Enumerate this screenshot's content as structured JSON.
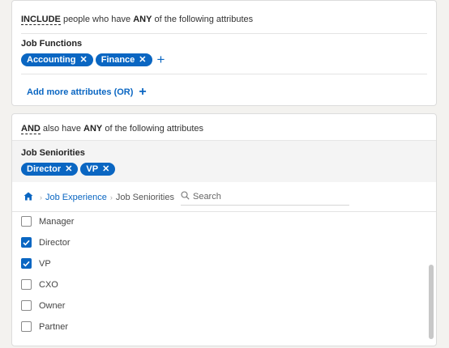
{
  "include_card": {
    "header_keyword": "INCLUDE",
    "header_mid": " people who have ",
    "header_any": "ANY",
    "header_tail": " of the following attributes",
    "section_title": "Job Functions",
    "pills": [
      "Accounting",
      "Finance"
    ],
    "add_more_label": "Add more attributes (OR)"
  },
  "and_card": {
    "header_keyword": "AND",
    "header_mid": " also have ",
    "header_any": "ANY",
    "header_tail": " of the following attributes",
    "section_title": "Job Seniorities",
    "pills": [
      "Director",
      "VP"
    ],
    "breadcrumb": {
      "link": "Job Experience",
      "current": "Job Seniorities"
    },
    "search": {
      "placeholder": "Search",
      "value": ""
    },
    "options": [
      {
        "label": "Manager",
        "checked": false
      },
      {
        "label": "Director",
        "checked": true
      },
      {
        "label": "VP",
        "checked": true
      },
      {
        "label": "CXO",
        "checked": false
      },
      {
        "label": "Owner",
        "checked": false
      },
      {
        "label": "Partner",
        "checked": false
      }
    ]
  },
  "icons": {
    "remove": "close-icon",
    "add": "plus-icon",
    "home": "home-icon",
    "search": "search-icon",
    "check": "checkmark-icon"
  },
  "colors": {
    "accent": "#0a66c2",
    "background": "#f3f2ef",
    "card": "#ffffff"
  }
}
